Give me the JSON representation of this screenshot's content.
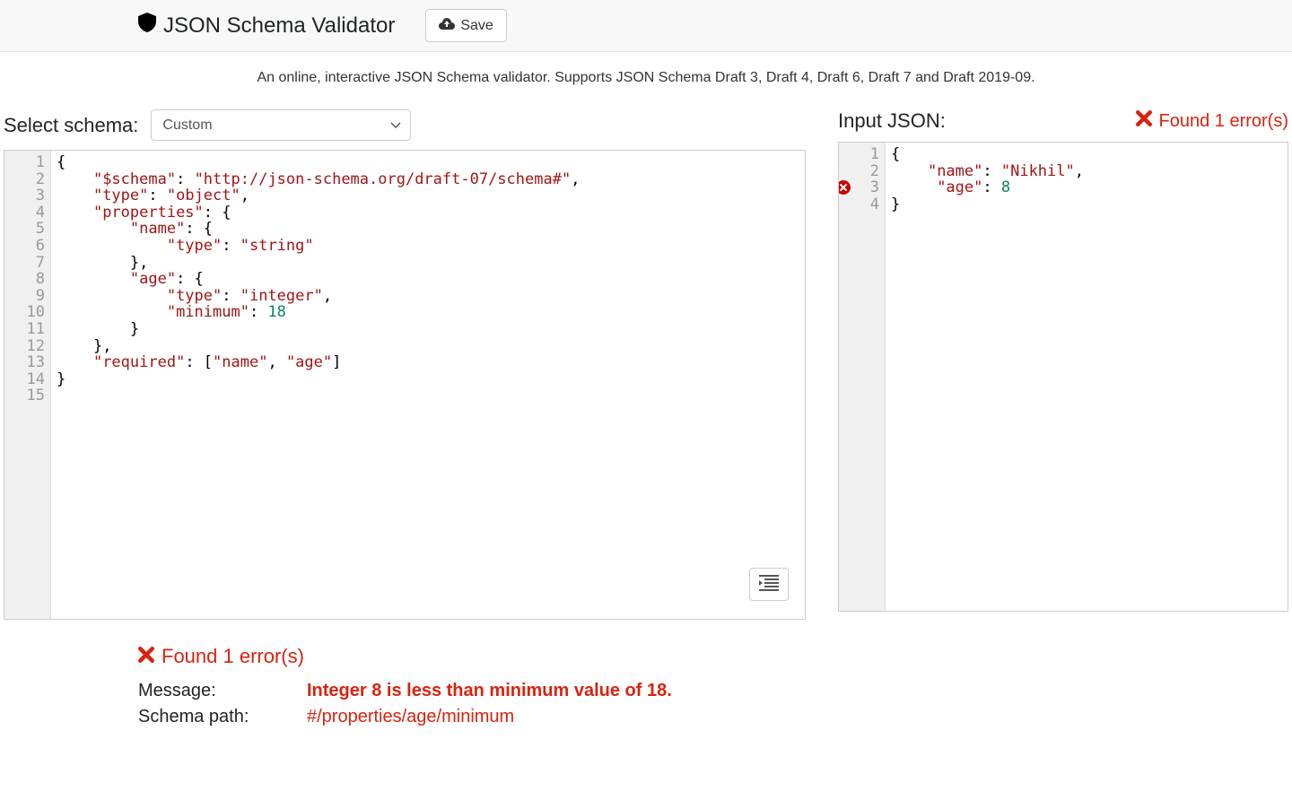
{
  "header": {
    "title": "JSON Schema Validator",
    "save_label": "Save"
  },
  "subtitle": "An online, interactive JSON Schema validator. Supports JSON Schema Draft 3, Draft 4, Draft 6, Draft 7 and Draft 2019-09.",
  "select_schema_label": "Select schema:",
  "schema_select_value": "Custom",
  "input_json_label": "Input JSON:",
  "error_banner": "Found 1 error(s)",
  "schema_lines": [
    [
      [
        "punc",
        "{"
      ]
    ],
    [
      [
        "ws",
        "    "
      ],
      [
        "key",
        "\"$schema\""
      ],
      [
        "punc",
        ": "
      ],
      [
        "str",
        "\"http://json-schema.org/draft-07/schema#\""
      ],
      [
        "punc",
        ","
      ]
    ],
    [
      [
        "ws",
        "    "
      ],
      [
        "key",
        "\"type\""
      ],
      [
        "punc",
        ": "
      ],
      [
        "str",
        "\"object\""
      ],
      [
        "punc",
        ","
      ]
    ],
    [
      [
        "ws",
        "    "
      ],
      [
        "key",
        "\"properties\""
      ],
      [
        "punc",
        ": {"
      ]
    ],
    [
      [
        "ws",
        "        "
      ],
      [
        "key",
        "\"name\""
      ],
      [
        "punc",
        ": {"
      ]
    ],
    [
      [
        "ws",
        "            "
      ],
      [
        "key",
        "\"type\""
      ],
      [
        "punc",
        ": "
      ],
      [
        "str",
        "\"string\""
      ]
    ],
    [
      [
        "ws",
        "        "
      ],
      [
        "punc",
        "},"
      ]
    ],
    [
      [
        "ws",
        "        "
      ],
      [
        "key",
        "\"age\""
      ],
      [
        "punc",
        ": {"
      ]
    ],
    [
      [
        "ws",
        "            "
      ],
      [
        "key",
        "\"type\""
      ],
      [
        "punc",
        ": "
      ],
      [
        "str",
        "\"integer\""
      ],
      [
        "punc",
        ","
      ]
    ],
    [
      [
        "ws",
        "            "
      ],
      [
        "key",
        "\"minimum\""
      ],
      [
        "punc",
        ": "
      ],
      [
        "num",
        "18"
      ]
    ],
    [
      [
        "ws",
        "        "
      ],
      [
        "punc",
        "}"
      ]
    ],
    [
      [
        "ws",
        "    "
      ],
      [
        "punc",
        "},"
      ]
    ],
    [
      [
        "ws",
        "    "
      ],
      [
        "key",
        "\"required\""
      ],
      [
        "punc",
        ": ["
      ],
      [
        "str",
        "\"name\""
      ],
      [
        "punc",
        ", "
      ],
      [
        "str",
        "\"age\""
      ],
      [
        "punc",
        "]"
      ]
    ],
    [
      [
        "punc",
        "}"
      ]
    ],
    []
  ],
  "input_lines": [
    [
      [
        "punc",
        "{"
      ]
    ],
    [
      [
        "ws",
        "    "
      ],
      [
        "key",
        "\"name\""
      ],
      [
        "punc",
        ": "
      ],
      [
        "str",
        "\"Nikhil\""
      ],
      [
        "punc",
        ","
      ]
    ],
    [
      [
        "ws",
        "     "
      ],
      [
        "key",
        "\"age\""
      ],
      [
        "punc",
        ": "
      ],
      [
        "num",
        "8"
      ]
    ],
    [
      [
        "punc",
        "}"
      ]
    ]
  ],
  "input_error_line": 3,
  "details": {
    "message_label": "Message:",
    "message_value": "Integer 8 is less than minimum value of 18.",
    "schema_path_label": "Schema path:",
    "schema_path_value": "#/properties/age/minimum"
  }
}
